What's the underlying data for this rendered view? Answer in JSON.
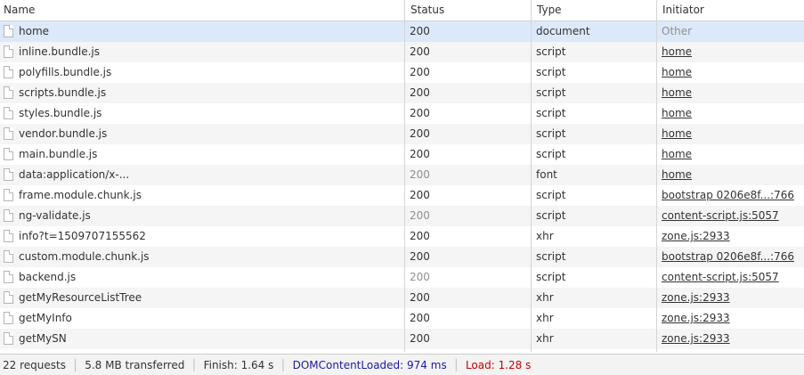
{
  "columns": {
    "name": "Name",
    "status": "Status",
    "type": "Type",
    "initiator": "Initiator"
  },
  "requests": [
    {
      "name": "home",
      "status": "200",
      "type": "document",
      "initiator": "Other",
      "initiator_link": false,
      "status_muted": false
    },
    {
      "name": "inline.bundle.js",
      "status": "200",
      "type": "script",
      "initiator": "home",
      "initiator_link": true,
      "status_muted": false
    },
    {
      "name": "polyfills.bundle.js",
      "status": "200",
      "type": "script",
      "initiator": "home",
      "initiator_link": true,
      "status_muted": false
    },
    {
      "name": "scripts.bundle.js",
      "status": "200",
      "type": "script",
      "initiator": "home",
      "initiator_link": true,
      "status_muted": false
    },
    {
      "name": "styles.bundle.js",
      "status": "200",
      "type": "script",
      "initiator": "home",
      "initiator_link": true,
      "status_muted": false
    },
    {
      "name": "vendor.bundle.js",
      "status": "200",
      "type": "script",
      "initiator": "home",
      "initiator_link": true,
      "status_muted": false
    },
    {
      "name": "main.bundle.js",
      "status": "200",
      "type": "script",
      "initiator": "home",
      "initiator_link": true,
      "status_muted": false
    },
    {
      "name": "data:application/x-...",
      "status": "200",
      "type": "font",
      "initiator": "home",
      "initiator_link": true,
      "status_muted": true
    },
    {
      "name": "frame.module.chunk.js",
      "status": "200",
      "type": "script",
      "initiator": "bootstrap 0206e8f...:766",
      "initiator_link": true,
      "status_muted": false
    },
    {
      "name": "ng-validate.js",
      "status": "200",
      "type": "script",
      "initiator": "content-script.js:5057",
      "initiator_link": true,
      "status_muted": true
    },
    {
      "name": "info?t=1509707155562",
      "status": "200",
      "type": "xhr",
      "initiator": "zone.js:2933",
      "initiator_link": true,
      "status_muted": false
    },
    {
      "name": "custom.module.chunk.js",
      "status": "200",
      "type": "script",
      "initiator": "bootstrap 0206e8f...:766",
      "initiator_link": true,
      "status_muted": false
    },
    {
      "name": "backend.js",
      "status": "200",
      "type": "script",
      "initiator": "content-script.js:5057",
      "initiator_link": true,
      "status_muted": true
    },
    {
      "name": "getMyResourceListTree",
      "status": "200",
      "type": "xhr",
      "initiator": "zone.js:2933",
      "initiator_link": true,
      "status_muted": false
    },
    {
      "name": "getMyInfo",
      "status": "200",
      "type": "xhr",
      "initiator": "zone.js:2933",
      "initiator_link": true,
      "status_muted": false
    },
    {
      "name": "getMySN",
      "status": "200",
      "type": "xhr",
      "initiator": "zone.js:2933",
      "initiator_link": true,
      "status_muted": false
    }
  ],
  "summary": {
    "requests": "22 requests",
    "transferred": "5.8 MB transferred",
    "finish": "Finish: 1.64 s",
    "dom_content_loaded": "DOMContentLoaded: 974 ms",
    "load": "Load: 1.28 s"
  },
  "colors": {
    "selected_row": "#dbe9fa",
    "dom_content_loaded": "#1a1aa6",
    "load": "#c80000"
  }
}
